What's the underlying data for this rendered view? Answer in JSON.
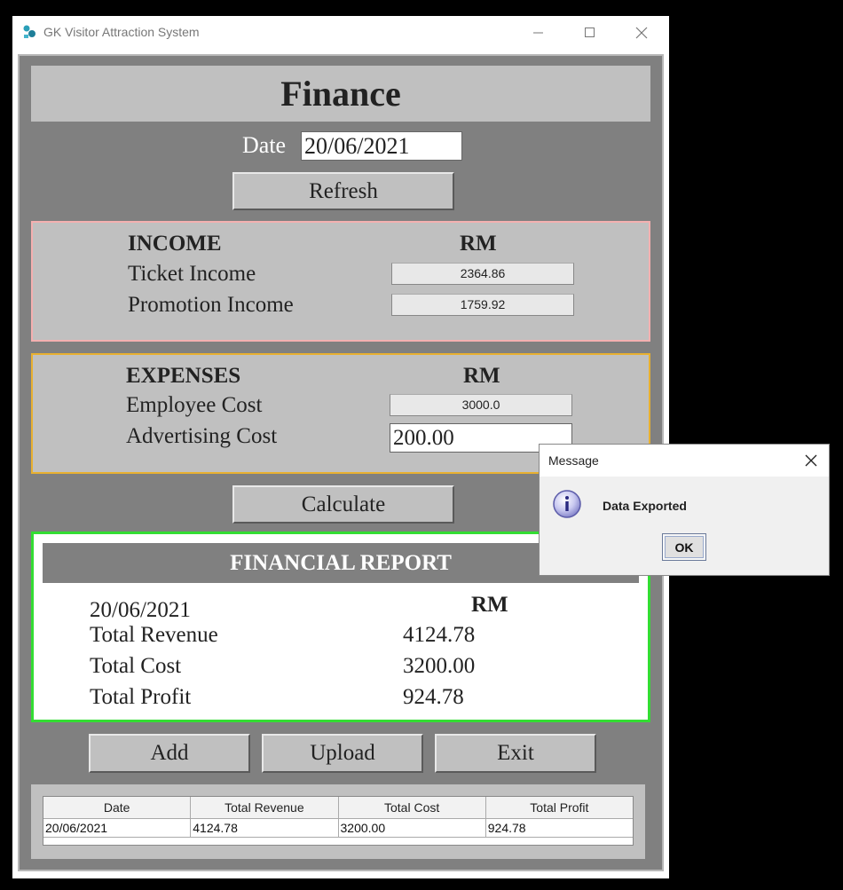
{
  "window": {
    "title": "GK Visitor Attraction System"
  },
  "header": {
    "title": "Finance"
  },
  "date": {
    "label": "Date",
    "value": "20/06/2021"
  },
  "buttons": {
    "refresh": "Refresh",
    "calculate": "Calculate",
    "add": "Add",
    "upload": "Upload",
    "exit": "Exit"
  },
  "income": {
    "heading": "INCOME",
    "currency": "RM",
    "ticket_label": "Ticket Income",
    "ticket_value": "2364.86",
    "promotion_label": "Promotion Income",
    "promotion_value": "1759.92"
  },
  "expenses": {
    "heading": "EXPENSES",
    "currency": "RM",
    "employee_label": "Employee Cost",
    "employee_value": "3000.0",
    "advertising_label": "Advertising Cost",
    "advertising_value": "200.00"
  },
  "report": {
    "heading": "FINANCIAL REPORT",
    "date": "20/06/2021",
    "currency": "RM",
    "revenue_label": "Total Revenue",
    "revenue_value": "4124.78",
    "cost_label": "Total Cost",
    "cost_value": "3200.00",
    "profit_label": "Total Profit",
    "profit_value": "924.78"
  },
  "table": {
    "columns": [
      "Date",
      "Total Revenue",
      "Total Cost",
      "Total Profit"
    ],
    "rows": [
      [
        "20/06/2021",
        "4124.78",
        "3200.00",
        "924.78"
      ]
    ]
  },
  "dialog": {
    "title": "Message",
    "message": "Data Exported",
    "ok": "OK"
  }
}
